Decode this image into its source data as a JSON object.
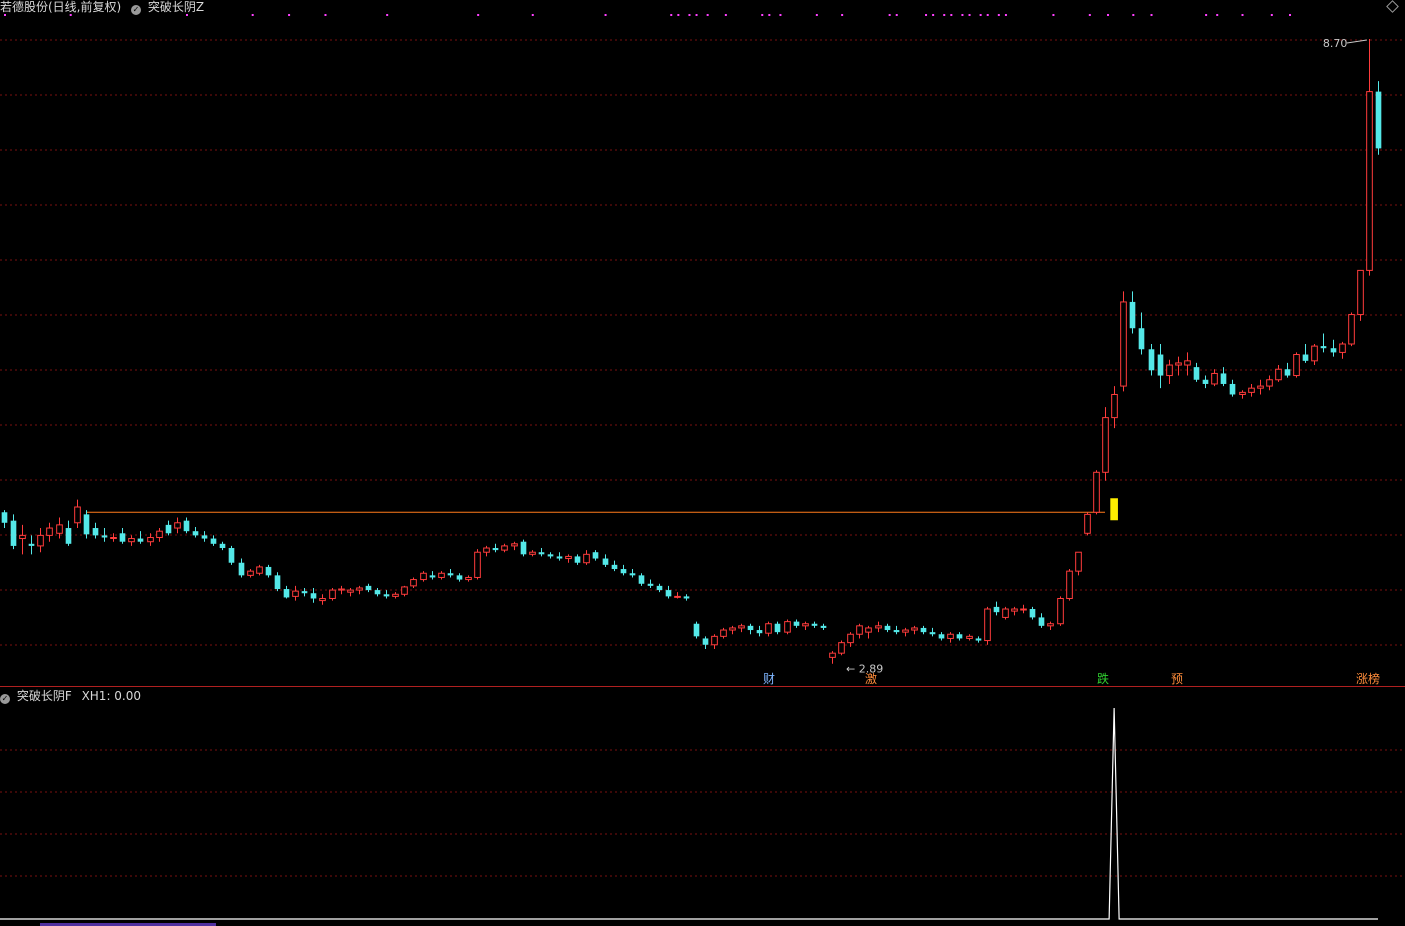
{
  "header": {
    "title": "若德股份(日线,前复权)",
    "indicator_icon": "check-circle-icon",
    "indicator_name": "突破长阴Z"
  },
  "sub_header": {
    "indicator_icon": "check-circle-icon",
    "indicator_name": "突破长阴F",
    "value_label": "XH1: 0.00"
  },
  "annotations": {
    "high_label": "8.70",
    "low_label": "2.89"
  },
  "events": [
    {
      "label": "财",
      "color": "#7fb6ff"
    },
    {
      "label": "激",
      "color": "#ff8c3a"
    },
    {
      "label": "跌",
      "color": "#30d030"
    },
    {
      "label": "预",
      "color": "#ff8c3a"
    },
    {
      "label": "涨榜",
      "color": "#ff8c3a"
    }
  ],
  "colors": {
    "up": "#ff3c3c",
    "down": "#54e8e8",
    "signal": "#ffee00",
    "grid": "#7a1010",
    "dots": "#ff40ff",
    "breakout_line": "#ff7a1a"
  },
  "chart_data": {
    "type": "candlestick",
    "ylim": [
      2.7,
      8.9
    ],
    "breakout_level": 4.2,
    "ohlc": [
      [
        4.2,
        4.22,
        4.05,
        4.1
      ],
      [
        4.12,
        4.18,
        3.85,
        3.88
      ],
      [
        3.95,
        4.08,
        3.8,
        3.98
      ],
      [
        3.9,
        3.98,
        3.8,
        3.88
      ],
      [
        3.88,
        4.05,
        3.82,
        3.98
      ],
      [
        3.98,
        4.1,
        3.92,
        4.05
      ],
      [
        4.0,
        4.15,
        3.95,
        4.08
      ],
      [
        4.05,
        4.12,
        3.88,
        3.9
      ],
      [
        4.1,
        4.32,
        4.05,
        4.25
      ],
      [
        4.18,
        4.22,
        3.95,
        3.99
      ],
      [
        4.05,
        4.1,
        3.95,
        3.98
      ],
      [
        3.98,
        4.05,
        3.92,
        3.96
      ],
      [
        3.96,
        4.0,
        3.92,
        3.96
      ],
      [
        4.0,
        4.05,
        3.9,
        3.92
      ],
      [
        3.92,
        3.98,
        3.88,
        3.95
      ],
      [
        3.95,
        4.02,
        3.9,
        3.92
      ],
      [
        3.92,
        4.0,
        3.88,
        3.96
      ],
      [
        3.96,
        4.05,
        3.92,
        4.02
      ],
      [
        4.08,
        4.12,
        3.98,
        4.0
      ],
      [
        4.05,
        4.15,
        4.0,
        4.1
      ],
      [
        4.12,
        4.15,
        4.0,
        4.02
      ],
      [
        4.02,
        4.06,
        3.96,
        3.98
      ],
      [
        3.98,
        4.02,
        3.92,
        3.95
      ],
      [
        3.95,
        3.98,
        3.88,
        3.9
      ],
      [
        3.9,
        3.92,
        3.84,
        3.86
      ],
      [
        3.86,
        3.88,
        3.7,
        3.72
      ],
      [
        3.72,
        3.76,
        3.58,
        3.6
      ],
      [
        3.6,
        3.66,
        3.58,
        3.64
      ],
      [
        3.62,
        3.7,
        3.6,
        3.68
      ],
      [
        3.68,
        3.7,
        3.58,
        3.6
      ],
      [
        3.6,
        3.63,
        3.45,
        3.47
      ],
      [
        3.47,
        3.5,
        3.38,
        3.39
      ],
      [
        3.4,
        3.5,
        3.36,
        3.45
      ],
      [
        3.45,
        3.48,
        3.4,
        3.43
      ],
      [
        3.43,
        3.48,
        3.34,
        3.38
      ],
      [
        3.36,
        3.42,
        3.32,
        3.38
      ],
      [
        3.38,
        3.48,
        3.36,
        3.46
      ],
      [
        3.46,
        3.5,
        3.42,
        3.47
      ],
      [
        3.44,
        3.48,
        3.4,
        3.46
      ],
      [
        3.46,
        3.5,
        3.42,
        3.48
      ],
      [
        3.5,
        3.52,
        3.44,
        3.46
      ],
      [
        3.46,
        3.48,
        3.4,
        3.42
      ],
      [
        3.42,
        3.46,
        3.38,
        3.4
      ],
      [
        3.4,
        3.44,
        3.38,
        3.42
      ],
      [
        3.42,
        3.5,
        3.4,
        3.49
      ],
      [
        3.5,
        3.58,
        3.48,
        3.56
      ],
      [
        3.56,
        3.64,
        3.54,
        3.62
      ],
      [
        3.6,
        3.64,
        3.56,
        3.58
      ],
      [
        3.58,
        3.64,
        3.56,
        3.62
      ],
      [
        3.62,
        3.66,
        3.58,
        3.6
      ],
      [
        3.6,
        3.62,
        3.54,
        3.56
      ],
      [
        3.56,
        3.6,
        3.54,
        3.58
      ],
      [
        3.58,
        3.85,
        3.56,
        3.82
      ],
      [
        3.82,
        3.88,
        3.78,
        3.86
      ],
      [
        3.86,
        3.9,
        3.82,
        3.84
      ],
      [
        3.84,
        3.9,
        3.82,
        3.88
      ],
      [
        3.88,
        3.92,
        3.84,
        3.9
      ],
      [
        3.92,
        3.94,
        3.78,
        3.8
      ],
      [
        3.8,
        3.84,
        3.78,
        3.82
      ],
      [
        3.82,
        3.86,
        3.78,
        3.8
      ],
      [
        3.8,
        3.82,
        3.76,
        3.78
      ],
      [
        3.78,
        3.82,
        3.74,
        3.76
      ],
      [
        3.76,
        3.8,
        3.72,
        3.78
      ],
      [
        3.78,
        3.8,
        3.7,
        3.72
      ],
      [
        3.72,
        3.84,
        3.7,
        3.8
      ],
      [
        3.82,
        3.84,
        3.74,
        3.76
      ],
      [
        3.76,
        3.8,
        3.68,
        3.7
      ],
      [
        3.7,
        3.74,
        3.64,
        3.66
      ],
      [
        3.66,
        3.7,
        3.6,
        3.62
      ],
      [
        3.62,
        3.66,
        3.58,
        3.6
      ],
      [
        3.6,
        3.62,
        3.5,
        3.52
      ],
      [
        3.52,
        3.56,
        3.48,
        3.5
      ],
      [
        3.5,
        3.52,
        3.44,
        3.46
      ],
      [
        3.46,
        3.5,
        3.38,
        3.4
      ],
      [
        3.4,
        3.44,
        3.38,
        3.4
      ],
      [
        3.4,
        3.42,
        3.36,
        3.38
      ],
      [
        3.14,
        3.16,
        3.0,
        3.02
      ],
      [
        3.0,
        3.02,
        2.9,
        2.94
      ],
      [
        2.94,
        3.04,
        2.9,
        3.02
      ],
      [
        3.02,
        3.1,
        3.0,
        3.08
      ],
      [
        3.08,
        3.12,
        3.04,
        3.1
      ],
      [
        3.1,
        3.14,
        3.06,
        3.12
      ],
      [
        3.12,
        3.14,
        3.04,
        3.08
      ],
      [
        3.08,
        3.12,
        3.02,
        3.05
      ],
      [
        3.05,
        3.16,
        3.02,
        3.14
      ],
      [
        3.14,
        3.16,
        3.04,
        3.06
      ],
      [
        3.06,
        3.18,
        3.04,
        3.16
      ],
      [
        3.16,
        3.18,
        3.1,
        3.12
      ],
      [
        3.12,
        3.16,
        3.08,
        3.14
      ],
      [
        3.14,
        3.16,
        3.1,
        3.12
      ],
      [
        3.12,
        3.14,
        3.08,
        3.1
      ],
      [
        2.82,
        2.88,
        2.76,
        2.86
      ],
      [
        2.86,
        2.98,
        2.84,
        2.96
      ],
      [
        2.96,
        3.06,
        2.92,
        3.04
      ],
      [
        3.04,
        3.14,
        3.0,
        3.12
      ],
      [
        3.06,
        3.12,
        3.0,
        3.1
      ],
      [
        3.1,
        3.16,
        3.06,
        3.12
      ],
      [
        3.12,
        3.14,
        3.06,
        3.08
      ],
      [
        3.08,
        3.12,
        3.04,
        3.06
      ],
      [
        3.06,
        3.1,
        3.02,
        3.08
      ],
      [
        3.08,
        3.12,
        3.04,
        3.1
      ],
      [
        3.1,
        3.12,
        3.04,
        3.06
      ],
      [
        3.06,
        3.1,
        3.02,
        3.04
      ],
      [
        3.04,
        3.06,
        2.98,
        3.0
      ],
      [
        3.0,
        3.06,
        2.96,
        3.04
      ],
      [
        3.04,
        3.06,
        2.98,
        3.0
      ],
      [
        3.0,
        3.04,
        2.98,
        3.02
      ],
      [
        3.0,
        3.02,
        2.96,
        2.98
      ],
      [
        2.98,
        3.3,
        2.94,
        3.28
      ],
      [
        3.3,
        3.35,
        3.22,
        3.25
      ],
      [
        3.2,
        3.3,
        3.18,
        3.28
      ],
      [
        3.26,
        3.3,
        3.22,
        3.28
      ],
      [
        3.28,
        3.32,
        3.24,
        3.28
      ],
      [
        3.28,
        3.3,
        3.18,
        3.2
      ],
      [
        3.2,
        3.24,
        3.1,
        3.12
      ],
      [
        3.12,
        3.16,
        3.08,
        3.14
      ],
      [
        3.14,
        3.4,
        3.12,
        3.38
      ],
      [
        3.38,
        3.66,
        3.36,
        3.64
      ],
      [
        3.64,
        3.82,
        3.6,
        3.82
      ],
      [
        4.0,
        4.2,
        3.98,
        4.18
      ],
      [
        4.2,
        4.6,
        4.18,
        4.58
      ],
      [
        4.58,
        5.2,
        4.5,
        5.1
      ],
      [
        5.1,
        5.4,
        5.0,
        5.32
      ],
      [
        5.4,
        6.3,
        5.35,
        6.2
      ],
      [
        6.2,
        6.3,
        5.9,
        5.95
      ],
      [
        5.95,
        6.1,
        5.7,
        5.75
      ],
      [
        5.75,
        5.8,
        5.5,
        5.55
      ],
      [
        5.7,
        5.8,
        5.38,
        5.5
      ],
      [
        5.5,
        5.65,
        5.42,
        5.6
      ],
      [
        5.6,
        5.68,
        5.5,
        5.62
      ],
      [
        5.6,
        5.72,
        5.5,
        5.64
      ],
      [
        5.58,
        5.62,
        5.44,
        5.46
      ],
      [
        5.46,
        5.5,
        5.38,
        5.42
      ],
      [
        5.42,
        5.56,
        5.4,
        5.52
      ],
      [
        5.52,
        5.58,
        5.4,
        5.42
      ],
      [
        5.42,
        5.46,
        5.3,
        5.32
      ],
      [
        5.32,
        5.36,
        5.28,
        5.34
      ],
      [
        5.34,
        5.42,
        5.3,
        5.38
      ],
      [
        5.38,
        5.46,
        5.32,
        5.4
      ],
      [
        5.4,
        5.5,
        5.36,
        5.46
      ],
      [
        5.46,
        5.6,
        5.44,
        5.56
      ],
      [
        5.56,
        5.62,
        5.48,
        5.5
      ],
      [
        5.5,
        5.72,
        5.48,
        5.7
      ],
      [
        5.7,
        5.8,
        5.62,
        5.64
      ],
      [
        5.64,
        5.8,
        5.6,
        5.78
      ],
      [
        5.78,
        5.9,
        5.72,
        5.76
      ],
      [
        5.76,
        5.84,
        5.68,
        5.72
      ],
      [
        5.72,
        5.82,
        5.66,
        5.8
      ],
      [
        5.8,
        6.1,
        5.78,
        6.08
      ],
      [
        6.08,
        6.5,
        6.02,
        6.5
      ],
      [
        6.5,
        8.7,
        6.45,
        8.2
      ],
      [
        8.2,
        8.3,
        7.6,
        7.66
      ]
    ],
    "sub_series": {
      "name": "XH1",
      "values_note": "zero everywhere except a single spike at the breakout bar",
      "spike_index": 122,
      "spike_value": 1
    }
  }
}
